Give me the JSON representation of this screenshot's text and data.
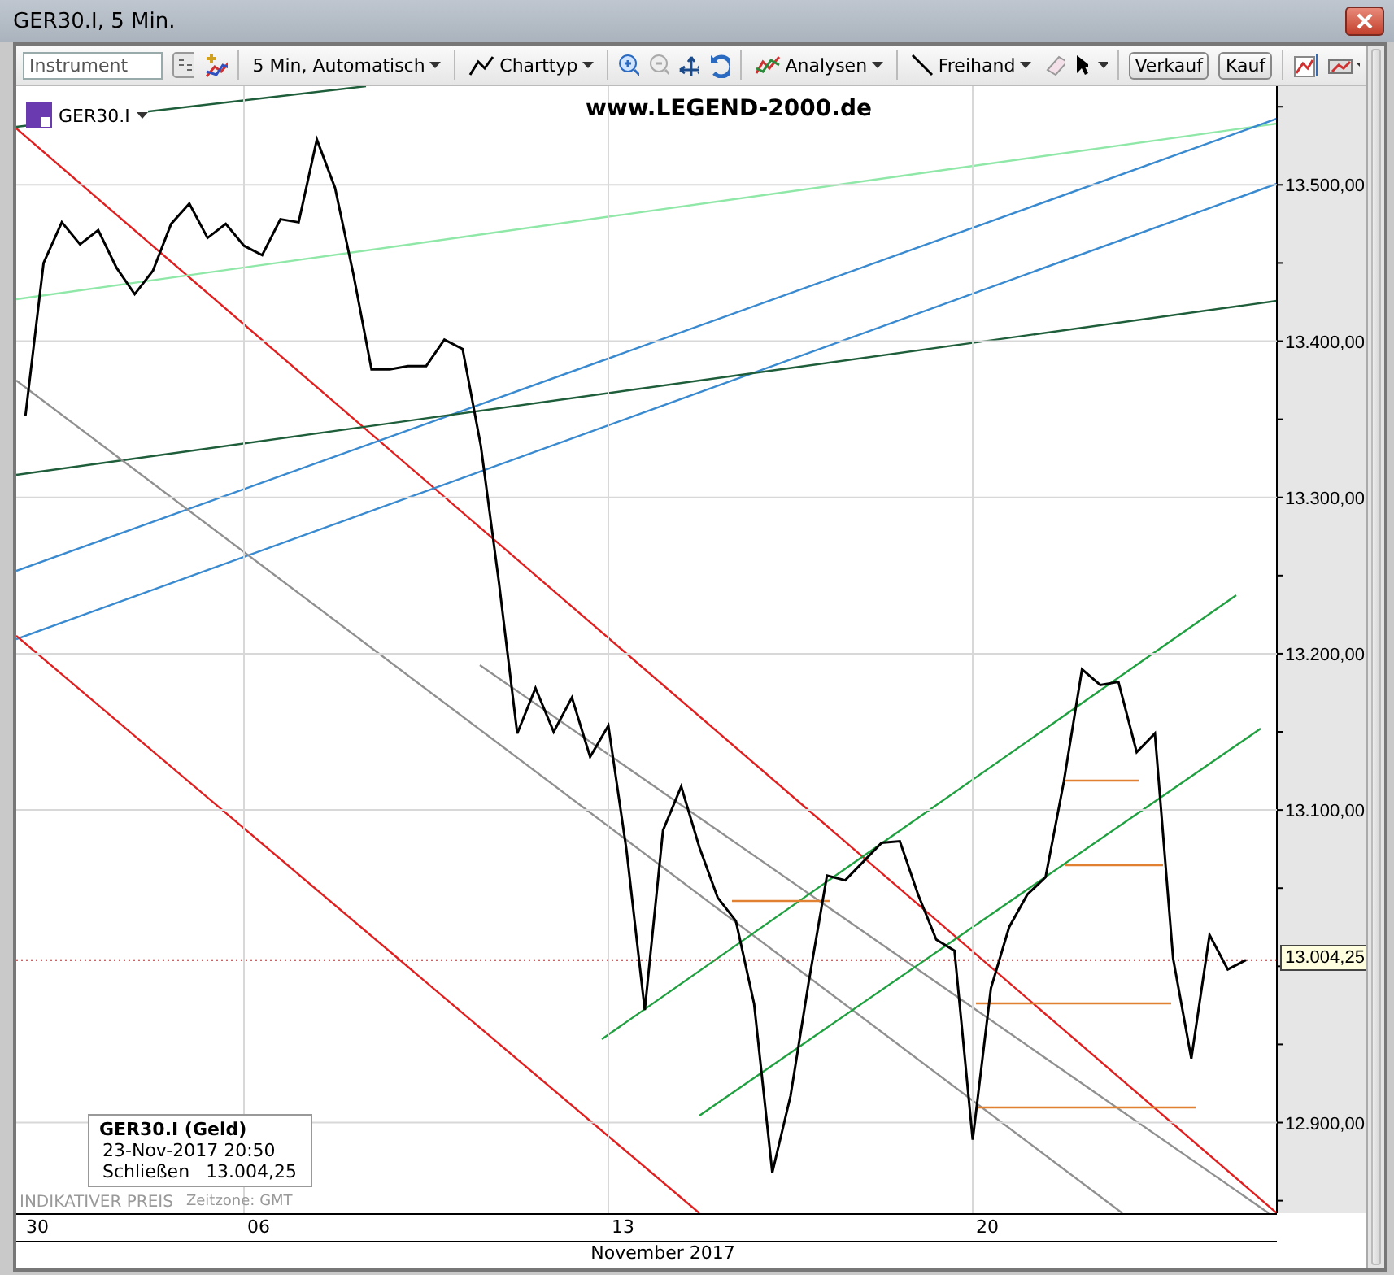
{
  "window": {
    "title": "GER30.I, 5 Min."
  },
  "toolbar": {
    "instrument_field": {
      "placeholder": "Instrument"
    },
    "items": [
      {
        "kind": "dropdown",
        "label": "5 Min, Automatisch"
      },
      {
        "kind": "dropdown",
        "label": "Charttyp"
      },
      {
        "kind": "dropdown",
        "label": "Analysen"
      },
      {
        "kind": "dropdown",
        "label": "Freihand"
      },
      {
        "kind": "button",
        "label": "Verkauf"
      },
      {
        "kind": "button",
        "label": "Kauf"
      }
    ]
  },
  "chart": {
    "symbol": "GER30.I",
    "watermark": "www.LEGEND-2000.de",
    "last_price": "13.004,25",
    "legend": {
      "title": "GER30.I (Geld)",
      "datetime": "23-Nov-2017 20:50",
      "close_label": "Schließen",
      "close_value": "13.004,25"
    },
    "date_labels": [
      "30",
      "06",
      "13",
      "20"
    ],
    "indicative": "INDIKATIVER PREIS",
    "timezone": "Zeitzone: GMT",
    "month": "November 2017",
    "chart_data": {
      "type": "line",
      "grid": true,
      "ylim": [
        12842,
        13560
      ],
      "yticks": [
        {
          "value": 12900,
          "label": "12.900,00"
        },
        {
          "value": 13100,
          "label": "13.100,00"
        },
        {
          "value": 13200,
          "label": "13.200,00"
        },
        {
          "value": 13300,
          "label": "13.300,00"
        },
        {
          "value": 13400,
          "label": "13.400,00"
        },
        {
          "value": 13500,
          "label": "13.500,00"
        }
      ],
      "series": [
        {
          "color": "#000000",
          "values": [
            13352,
            13450,
            13476,
            13462,
            13471,
            13447,
            13430,
            13445,
            13475,
            13488,
            13466,
            13475,
            13461,
            13455,
            13478,
            13476,
            13529,
            13498,
            13443,
            13382,
            13382,
            13384,
            13384,
            13401,
            13395,
            13333,
            13245,
            13149,
            13178,
            13150,
            13172,
            13134,
            13154,
            13074,
            12972,
            13087,
            13115,
            13076,
            13044,
            13029,
            12976,
            12868,
            12917,
            12990,
            13058,
            13055,
            13067,
            13079,
            13080,
            13046,
            13017,
            13010,
            12889,
            12986,
            13025,
            13046,
            13057,
            13118,
            13190,
            13180,
            13182,
            13137,
            13149,
            13005,
            12941,
            13020,
            12998,
            13004
          ]
        }
      ]
    }
  }
}
